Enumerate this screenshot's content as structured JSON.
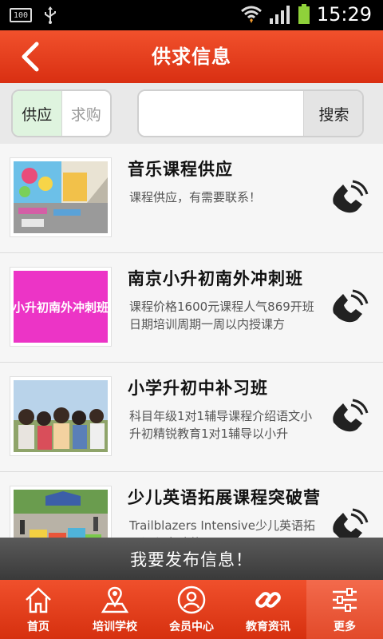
{
  "status_bar": {
    "battery_small": "100",
    "time": "15:29"
  },
  "header": {
    "title": "供求信息"
  },
  "filter": {
    "supply_label": "供应",
    "demand_label": "求购"
  },
  "search": {
    "placeholder": "",
    "value": "",
    "button_label": "搜索"
  },
  "listings": [
    {
      "title": "音乐课程供应",
      "description": "课程供应，有需要联系！",
      "icon": "phone-icon",
      "image_text": ""
    },
    {
      "title": "南京小升初南外冲刺班",
      "description": "课程价格1600元课程人气869开班日期培训周期一周以内授课方",
      "icon": "phone-icon",
      "image_text": "小升初南外冲刺班"
    },
    {
      "title": "小学升初中补习班",
      "description": "科目年级1对1辅导课程介绍语文小升初精锐教育1对1辅导以小升",
      "icon": "phone-icon",
      "image_text": ""
    },
    {
      "title": "少儿英语拓展课程突破营",
      "description": "Trailblazers Intensive少儿英语拓展课程突破营",
      "icon": "phone-icon",
      "image_text": ""
    }
  ],
  "publish": {
    "label": "我要发布信息！"
  },
  "tabs": [
    {
      "label": "首页",
      "icon": "home-icon"
    },
    {
      "label": "培训学校",
      "icon": "school-map-icon"
    },
    {
      "label": "会员中心",
      "icon": "user-icon"
    },
    {
      "label": "教育资讯",
      "icon": "link-icon"
    },
    {
      "label": "更多",
      "icon": "settings-sliders-icon"
    }
  ],
  "colors": {
    "brand": "#e13d1c",
    "active_segment": "#dff4df",
    "publish_bar": "#4a4a4a"
  }
}
